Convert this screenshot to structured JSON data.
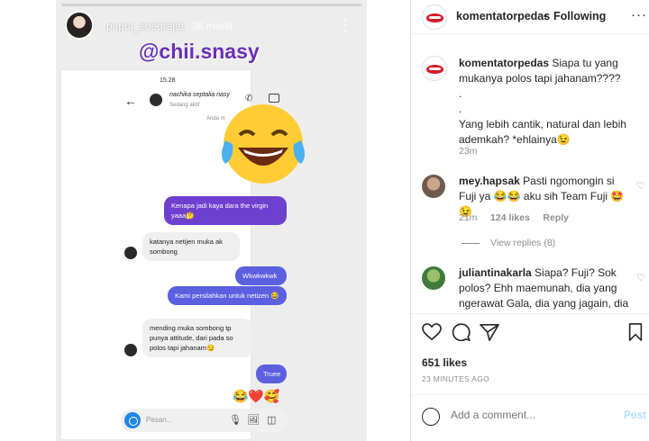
{
  "story": {
    "username": "puput_soedrajat",
    "time": "36 menit",
    "mention": "@chii.snasy",
    "status_time": "15.28",
    "chat_name": "nachika septalia nasy",
    "chat_status": "Sedang aktif",
    "anda_label": "Anda m",
    "messages": [
      {
        "side": "out",
        "text": "Kenapa jadi kaya dara the virgin yaaa🤔"
      },
      {
        "side": "in",
        "text": "katanya netijen muka ak sombong"
      },
      {
        "side": "out",
        "text": "Wkwkwkwk"
      },
      {
        "side": "out",
        "text": "Kami persilahkan untuk netizen 😂"
      },
      {
        "side": "in",
        "text": "mending muka sombong tp punya attitude, dari pada so polos tapi jahanam😏"
      },
      {
        "side": "out",
        "text": "Truee"
      }
    ],
    "reactions": "😂❤️🥰",
    "composer_placeholder": "Pesan..."
  },
  "post": {
    "account": "komentatorpedas",
    "follow_label": "Following",
    "caption_lines": [
      "Siapa tu yang mukanya polos tapi jahanam????",
      ".",
      ".",
      "Yang lebih cantik, natural dan lebih ademkah? *ehlainya😉"
    ],
    "caption_time": "23m",
    "comments": [
      {
        "user": "mey.hapsak",
        "text": "Pasti ngomongin si Fuji ya 😂😂 aku sih Team Fuji 🤩😉",
        "time": "21m",
        "likes": "124 likes",
        "reply": "Reply",
        "view_replies": "View replies (8)"
      },
      {
        "user": "juliantinakarla",
        "text": "Siapa? Fuji? Sok polos? Ehh maemunah, dia yang ngerawat Gala, dia yang jagain, dia yang ngurusin, dia yang kurang"
      }
    ],
    "likes": "651 likes",
    "posted_ago": "23 MINUTES AGO",
    "add_comment_placeholder": "Add a comment...",
    "post_label": "Post"
  }
}
